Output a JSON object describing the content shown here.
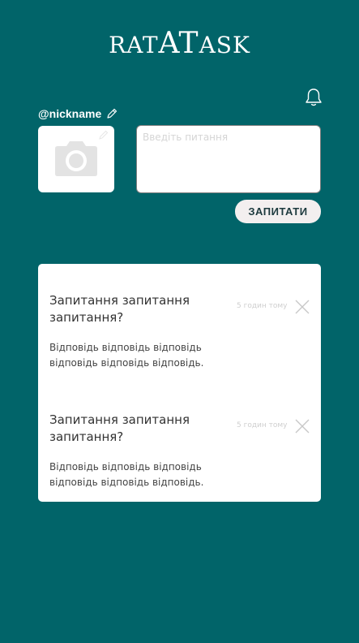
{
  "logo": {
    "part1": "RAT",
    "part2": "AT",
    "part3": "ASK"
  },
  "profile": {
    "nickname": "@nickname"
  },
  "ask": {
    "placeholder": "Введіть питання",
    "button_label": "ЗАПИТАТИ"
  },
  "questions": [
    {
      "question": "Запитання запитання запитання?",
      "time": "5 годин тому",
      "answer": "Відповідь відповідь відповідь відповідь відповідь відповідь."
    },
    {
      "question": "Запитання запитання запитання?",
      "time": "5 годин тому",
      "answer": "Відповідь відповідь відповідь відповідь відповідь відповідь."
    }
  ],
  "icons": {
    "bell": "bell-icon",
    "pencil": "pencil-icon",
    "camera": "camera-icon",
    "close": "close-icon"
  },
  "colors": {
    "background": "#016469",
    "panel": "#ffffff",
    "button": "#f3efef",
    "button_text": "#1d3a3e",
    "muted": "#cfcfcf"
  }
}
